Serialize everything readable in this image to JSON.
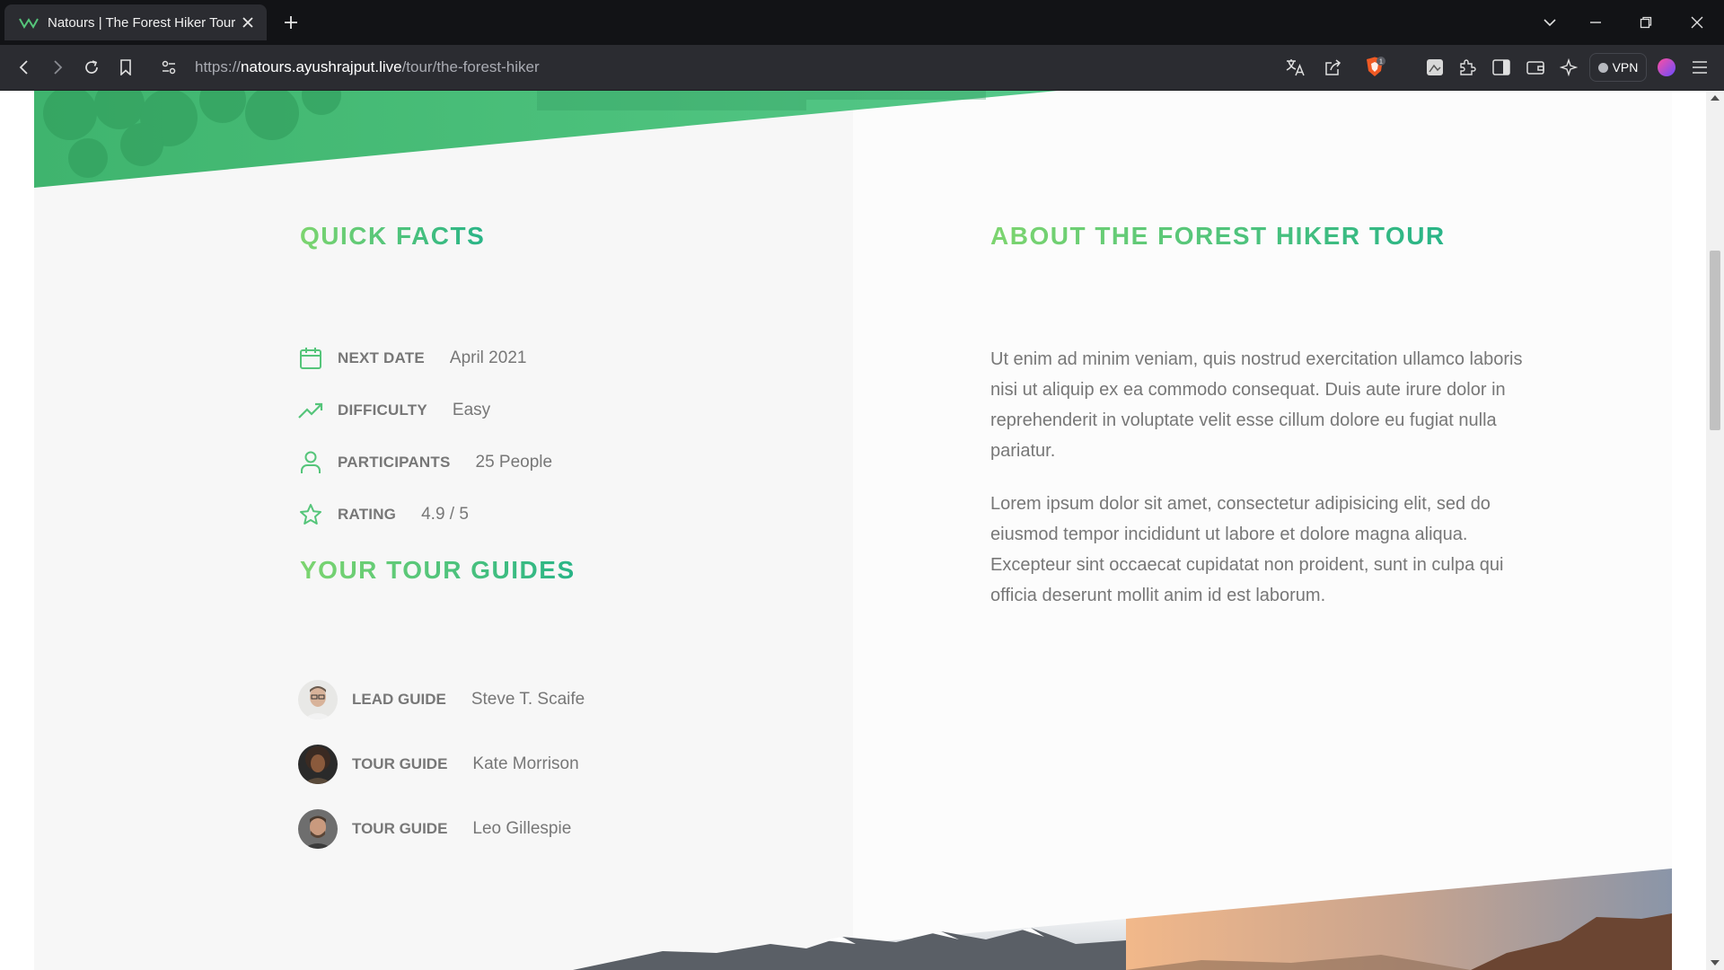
{
  "browser": {
    "tab_title": "Natours | The Forest Hiker Tour",
    "url_scheme": "https://",
    "url_host": "natours.ayushrajput.live",
    "url_path": "/tour/the-forest-hiker",
    "vpn_label": "VPN",
    "shield_badge": "1"
  },
  "quick_facts": {
    "title": "Quick facts",
    "items": [
      {
        "icon": "calendar-icon",
        "label": "Next date",
        "value": "April 2021"
      },
      {
        "icon": "trending-up-icon",
        "label": "Difficulty",
        "value": "Easy"
      },
      {
        "icon": "user-icon",
        "label": "Participants",
        "value": "25 People"
      },
      {
        "icon": "star-icon",
        "label": "Rating",
        "value": "4.9 / 5"
      }
    ]
  },
  "guides": {
    "title": "Your tour guides",
    "items": [
      {
        "role": "Lead guide",
        "name": "Steve T. Scaife"
      },
      {
        "role": "Tour guide",
        "name": "Kate Morrison"
      },
      {
        "role": "Tour guide",
        "name": "Leo Gillespie"
      }
    ]
  },
  "about": {
    "title": "About the forest hiker tour",
    "paragraphs": [
      "Ut enim ad minim veniam, quis nostrud exercitation ullamco laboris nisi ut aliquip ex ea commodo consequat. Duis aute irure dolor in reprehenderit in voluptate velit esse cillum dolore eu fugiat nulla pariatur.",
      "Lorem ipsum dolor sit amet, consectetur adipisicing elit, sed do eiusmod tempor incididunt ut labore et dolore magna aliqua. Excepteur sint occaecat cupidatat non proident, sunt in culpa qui officia deserunt mollit anim id est laborum."
    ]
  },
  "colors": {
    "accent_light": "#7dd56f",
    "accent_dark": "#28b487",
    "text_grey": "#777777"
  }
}
